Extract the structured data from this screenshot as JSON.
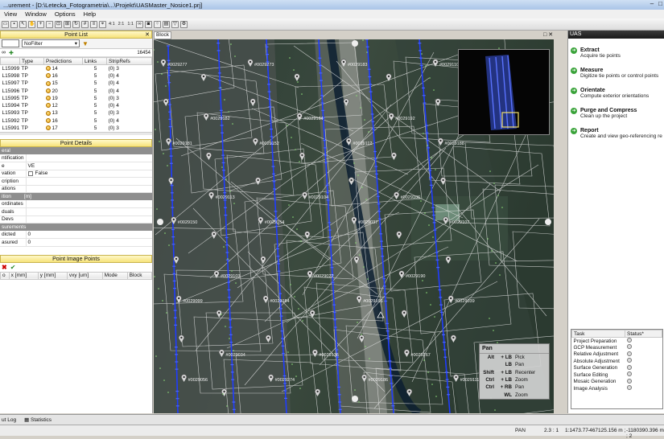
{
  "title": "...urement - [D:\\Letecka_Fotogrametria\\...\\Projekt\\UASMaster_Nosice1.prj]",
  "menu": [
    "View",
    "Window",
    "Options",
    "Help"
  ],
  "toolbar_labels": [
    "4:1",
    "2:1",
    "1:1"
  ],
  "point_list": {
    "title": "Point List",
    "filter": "NoFilter",
    "count": "16454",
    "columns": [
      "",
      "Type",
      "Predictions",
      "Links",
      "StripRefs"
    ],
    "rows": [
      {
        "id": "L15999",
        "type": "TP",
        "pred": "14",
        "links": "5",
        "strip": "(0) 3"
      },
      {
        "id": "L15998",
        "type": "TP",
        "pred": "16",
        "links": "5",
        "strip": "(0) 4"
      },
      {
        "id": "L15997",
        "type": "TP",
        "pred": "15",
        "links": "5",
        "strip": "(0) 4"
      },
      {
        "id": "L15996",
        "type": "TP",
        "pred": "20",
        "links": "5",
        "strip": "(0) 4"
      },
      {
        "id": "L15995",
        "type": "TP",
        "pred": "19",
        "links": "5",
        "strip": "(0) 3"
      },
      {
        "id": "L15994",
        "type": "TP",
        "pred": "12",
        "links": "5",
        "strip": "(0) 4"
      },
      {
        "id": "L15993",
        "type": "TP",
        "pred": "13",
        "links": "5",
        "strip": "(0) 3"
      },
      {
        "id": "L15992",
        "type": "TP",
        "pred": "16",
        "links": "5",
        "strip": "(0) 4"
      },
      {
        "id": "L15991",
        "type": "TP",
        "pred": "17",
        "links": "5",
        "strip": "(0) 3"
      }
    ]
  },
  "point_details": {
    "title": "Point Details",
    "sections": [
      {
        "name": "eral",
        "rows": [
          [
            "ntification",
            ""
          ],
          [
            "e",
            "VE"
          ],
          [
            "vation",
            "False"
          ],
          [
            "cription",
            ""
          ],
          [
            "ations",
            ""
          ]
        ]
      },
      {
        "name": "ition",
        "unit": "[m]",
        "rows": [
          [
            "ordinates",
            ""
          ],
          [
            "duals",
            ""
          ],
          [
            "Devs",
            ""
          ]
        ]
      },
      {
        "name": "surements",
        "rows": [
          [
            "dicted",
            "0"
          ],
          [
            "asured",
            "0"
          ]
        ]
      }
    ]
  },
  "point_image_points": {
    "title": "Point Image Points",
    "columns": [
      "o",
      "x [mm]",
      "y [mm]",
      "vxy [um]",
      "Mode",
      "Block"
    ]
  },
  "block_tab": "Block",
  "map_labels": [
    "#0029277",
    "#0029181",
    "#0029150",
    "#0029099",
    "#0029056",
    "#0029182",
    "#0029113",
    "#0029103",
    "#0029034",
    "#0029273",
    "#0029152",
    "#0029154",
    "#0029184",
    "#0029274",
    "#0029164",
    "#0029104",
    "#0029022",
    "#0029136",
    "#0029183",
    "#0029112",
    "#0029037",
    "#0029166",
    "#0029186",
    "#0029192",
    "#0029106",
    "#0029190",
    "#0029267",
    "#0029110",
    "#0029188",
    "#0029107",
    "#0029039",
    "#0029111",
    "#0029270"
  ],
  "pan_box": {
    "title": "Pan",
    "rows": [
      {
        "mod": "Alt",
        "btn": "+ LB",
        "act": "Pick"
      },
      {
        "mod": "",
        "btn": "LB",
        "act": "Pan"
      },
      {
        "mod": "Shift",
        "btn": "+ LB",
        "act": "Recenter"
      },
      {
        "mod": "Ctrl",
        "btn": "+ LB",
        "act": "Zoom"
      },
      {
        "mod": "Ctrl",
        "btn": "+ RB",
        "act": "Pan"
      },
      {
        "mod": "",
        "btn": "WL",
        "act": "Zoom"
      }
    ]
  },
  "uas": {
    "title": "UAS",
    "steps": [
      {
        "title": "Extract",
        "desc": "Acquire tie points"
      },
      {
        "title": "Measure",
        "desc": "Digitize tie points or control points"
      },
      {
        "title": "Orientate",
        "desc": "Compute exterior orientations"
      },
      {
        "title": "Purge and Compress",
        "desc": "Clean up the project"
      },
      {
        "title": "Report",
        "desc": "Create and view geo-referencing re"
      }
    ],
    "task_columns": [
      "Task",
      "Status*"
    ],
    "tasks": [
      "Project Preparation",
      "GCP Measurement",
      "Relative Adjustment",
      "Absolute Adjustment",
      "Surface Generation",
      "Surface Editing",
      "Mosaic Generation",
      "Image Analysis"
    ]
  },
  "bottom_tabs": [
    "ut Log",
    "Statistics"
  ],
  "status": {
    "mode": "PAN",
    "zoom": "2.3 : 1",
    "scale": "1:1473.77",
    "x": "-467125.156 m ;",
    "y": "-1180390.396 m ; 2"
  },
  "colors": {
    "panel_header": "#f6e27a",
    "accent_green": "#3aa33a",
    "flight_line": "#1f3cff"
  }
}
